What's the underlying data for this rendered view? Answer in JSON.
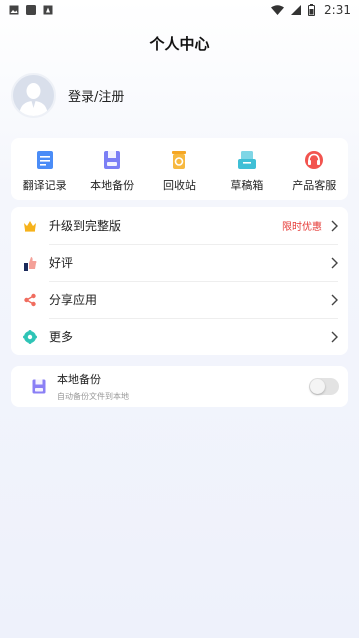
{
  "status_bar": {
    "time": "2:31",
    "left_icons": [
      "image-icon",
      "app-icon",
      "notification-icon"
    ],
    "right_icons": [
      "wifi-icon",
      "signal-icon",
      "battery-icon"
    ]
  },
  "header": {
    "title": "个人中心"
  },
  "profile": {
    "login_label": "登录/注册",
    "avatar_icon": "user-avatar-icon"
  },
  "tools": [
    {
      "label": "翻译记录",
      "icon": "translate-record-icon",
      "color": "#4a8cf7"
    },
    {
      "label": "本地备份",
      "icon": "local-backup-icon",
      "color": "#7b7ff5"
    },
    {
      "label": "回收站",
      "icon": "recycle-bin-icon",
      "color": "#f5a623"
    },
    {
      "label": "草稿箱",
      "icon": "drafts-icon",
      "color": "#3fbfd6"
    },
    {
      "label": "产品客服",
      "icon": "customer-service-icon",
      "color": "#f2544f"
    }
  ],
  "menu": [
    {
      "label": "升级到完整版",
      "badge": "限时优惠",
      "icon": "crown-icon"
    },
    {
      "label": "好评",
      "badge": "",
      "icon": "thumbs-up-icon"
    },
    {
      "label": "分享应用",
      "badge": "",
      "icon": "share-icon"
    },
    {
      "label": "更多",
      "badge": "",
      "icon": "more-icon"
    }
  ],
  "backup": {
    "title": "本地备份",
    "subtitle": "自动备份文件到本地",
    "enabled": false,
    "icon": "local-backup-icon"
  },
  "colors": {
    "accent": "#4a8cf7",
    "badge": "#e53935"
  }
}
